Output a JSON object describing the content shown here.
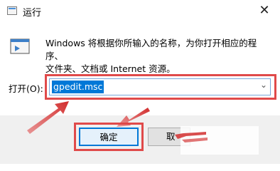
{
  "window": {
    "title": "运行",
    "close_glyph": "✕"
  },
  "description": {
    "line1": "Windows 将根据你所输入的名称，为你打开相应的程序、",
    "line2": "文件夹、文档或 Internet 资源。"
  },
  "open": {
    "label": "打开(O):",
    "value": "gpedit.msc",
    "chevron": "⌄"
  },
  "buttons": {
    "ok_label": "确定",
    "cancel_label": "取"
  },
  "colors": {
    "annotation_red": "#e04a4a",
    "selection_blue": "#0078d7"
  },
  "icons": {
    "title": "run-window-icon",
    "run": "run-app-icon",
    "close": "close-icon",
    "dropdown": "chevron-down-icon"
  }
}
